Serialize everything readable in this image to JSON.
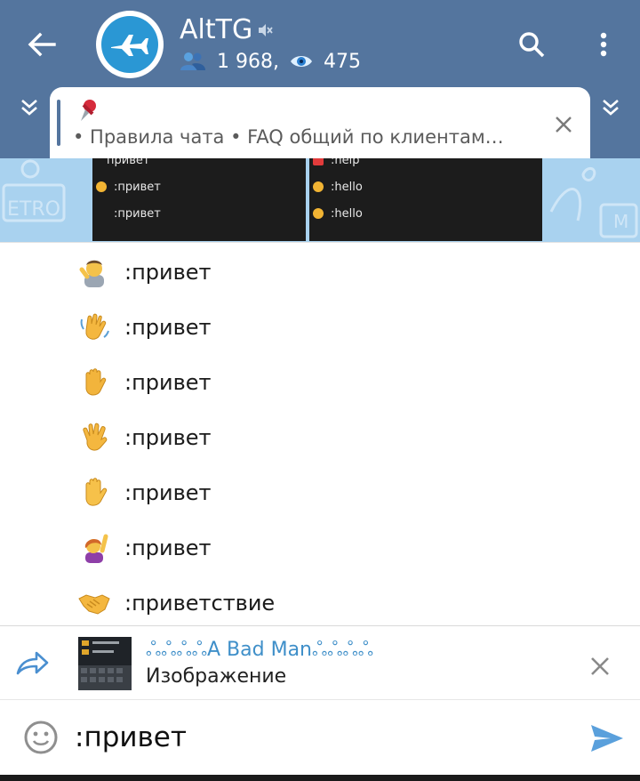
{
  "header": {
    "title": "AltTG",
    "members_count": "1 968,",
    "online_count": "475",
    "colors": {
      "bar": "#54759e",
      "accent": "#2a97d4"
    }
  },
  "pinned": {
    "text": "• Правила чата  • FAQ общий по клиентам…"
  },
  "screenshots": {
    "left": [
      "привет",
      ":привет",
      ":привет"
    ],
    "right": [
      ":help",
      ":hello",
      ":hello"
    ]
  },
  "suggestions": [
    {
      "emoji": "man-tipping-hand",
      "label": ":привет"
    },
    {
      "emoji": "waving-hand",
      "label": ":привет"
    },
    {
      "emoji": "raised-back-of-hand",
      "label": ":привет"
    },
    {
      "emoji": "hand-fingers-splayed",
      "label": ":привет"
    },
    {
      "emoji": "raised-hand",
      "label": ":привет"
    },
    {
      "emoji": "woman-raising-hand",
      "label": ":привет"
    },
    {
      "emoji": "handshake",
      "label": ":приветствие"
    }
  ],
  "reply": {
    "author": "ஃஃஃஃA Bad Manஃஃஃஃ",
    "preview": "Изображение"
  },
  "composer": {
    "value": ":привет"
  }
}
